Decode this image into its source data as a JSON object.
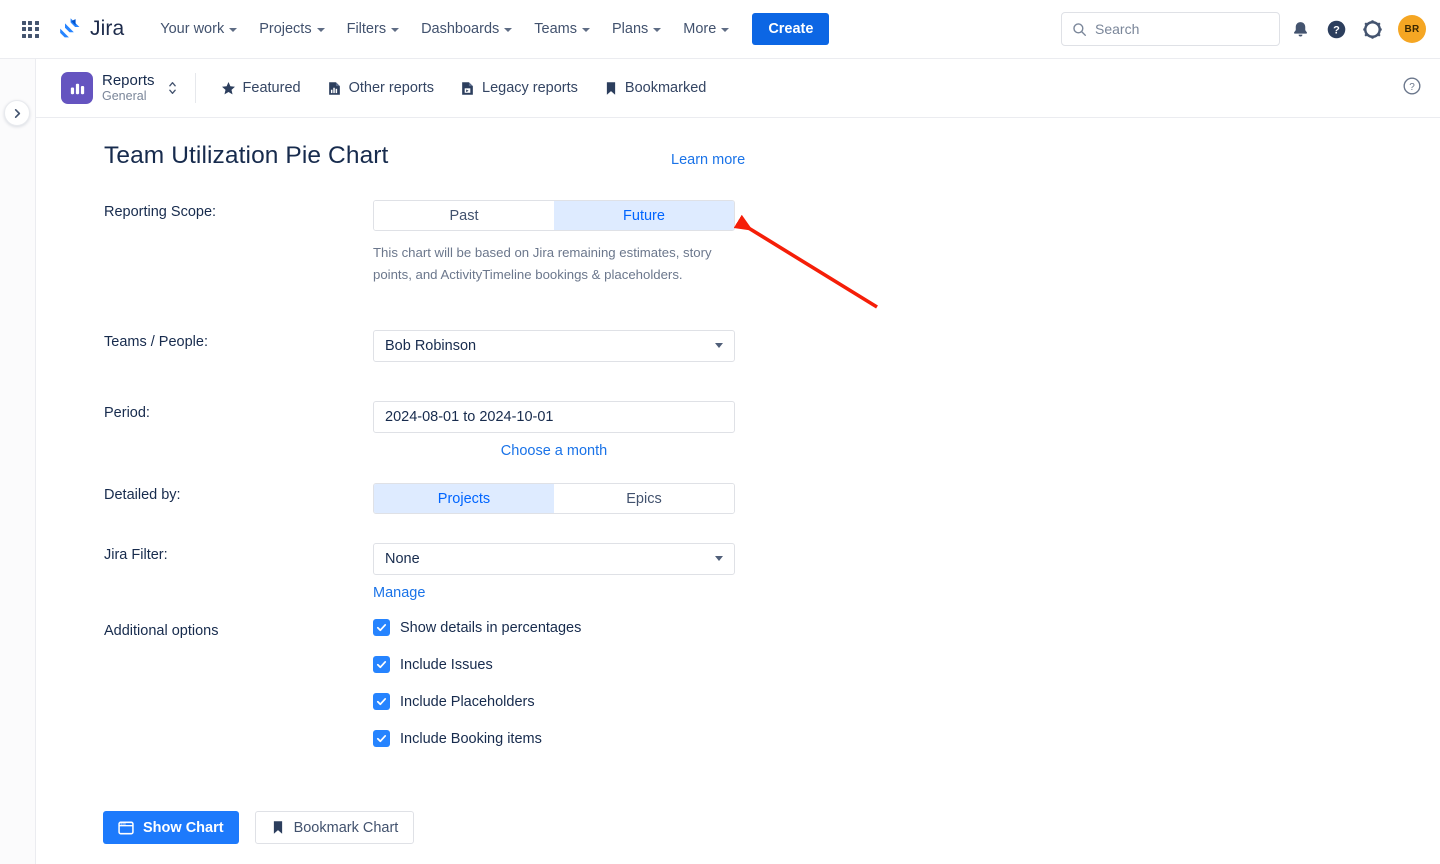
{
  "topnav": {
    "app_switcher_icon": "grid-apps-icon",
    "brand": "Jira",
    "items": [
      {
        "label": "Your work",
        "has_caret": true
      },
      {
        "label": "Projects",
        "has_caret": true
      },
      {
        "label": "Filters",
        "has_caret": true
      },
      {
        "label": "Dashboards",
        "has_caret": true
      },
      {
        "label": "Teams",
        "has_caret": true
      },
      {
        "label": "Plans",
        "has_caret": true
      },
      {
        "label": "More",
        "has_caret": true
      }
    ],
    "create_label": "Create",
    "search_placeholder": "Search",
    "search_value": "",
    "notifications_icon": "bell-icon",
    "help_icon": "help-circle-icon",
    "settings_icon": "gear-icon",
    "avatar_initials": "BR"
  },
  "subnav": {
    "app_name": "Reports",
    "app_section": "General",
    "app_icon": "bar-chart-icon",
    "tabs": [
      {
        "label": "Featured",
        "icon": "star-icon"
      },
      {
        "label": "Other reports",
        "icon": "report-chart-icon"
      },
      {
        "label": "Legacy reports",
        "icon": "legacy-document-icon"
      },
      {
        "label": "Bookmarked",
        "icon": "bookmark-icon"
      }
    ],
    "help_icon": "help-circle-outline-icon",
    "expand_rail_icon": "chevron-right-icon"
  },
  "page": {
    "title": "Team Utilization Pie Chart",
    "learn_more": "Learn more"
  },
  "form": {
    "reporting_scope": {
      "label": "Reporting Scope:",
      "options": [
        "Past",
        "Future"
      ],
      "selected": "Future",
      "help_text": "This chart will be based on Jira remaining estimates, story points, and ActivityTimeline bookings & placeholders."
    },
    "teams_people": {
      "label": "Teams / People:",
      "value": "Bob Robinson"
    },
    "period": {
      "label": "Period:",
      "value": "2024-08-01 to 2024-10-01",
      "choose_month_link": "Choose a month"
    },
    "detailed_by": {
      "label": "Detailed by:",
      "options": [
        "Projects",
        "Epics"
      ],
      "selected": "Projects"
    },
    "jira_filter": {
      "label": "Jira Filter:",
      "value": "None",
      "manage_link": "Manage"
    },
    "additional_options": {
      "label": "Additional options",
      "checkboxes": [
        {
          "label": "Show details in percentages",
          "checked": true
        },
        {
          "label": "Include Issues",
          "checked": true
        },
        {
          "label": "Include Placeholders",
          "checked": true
        },
        {
          "label": "Include Booking items",
          "checked": true
        }
      ]
    }
  },
  "actions": {
    "show_chart": "Show Chart",
    "show_chart_icon": "window-chart-icon",
    "bookmark_chart": "Bookmark Chart",
    "bookmark_chart_icon": "bookmark-icon"
  },
  "annotation": {
    "arrow_color": "#f51e08",
    "arrow_target": "future-toggle-option"
  },
  "colors": {
    "brand_blue": "#0c66e4",
    "accent_blue": "#1a73e8",
    "toggle_active_bg": "#deebff",
    "toggle_active_text": "#0065ff",
    "app_icon_purple": "#6554c0",
    "avatar_orange": "#f5a623",
    "checkbox_blue": "#2684ff"
  }
}
